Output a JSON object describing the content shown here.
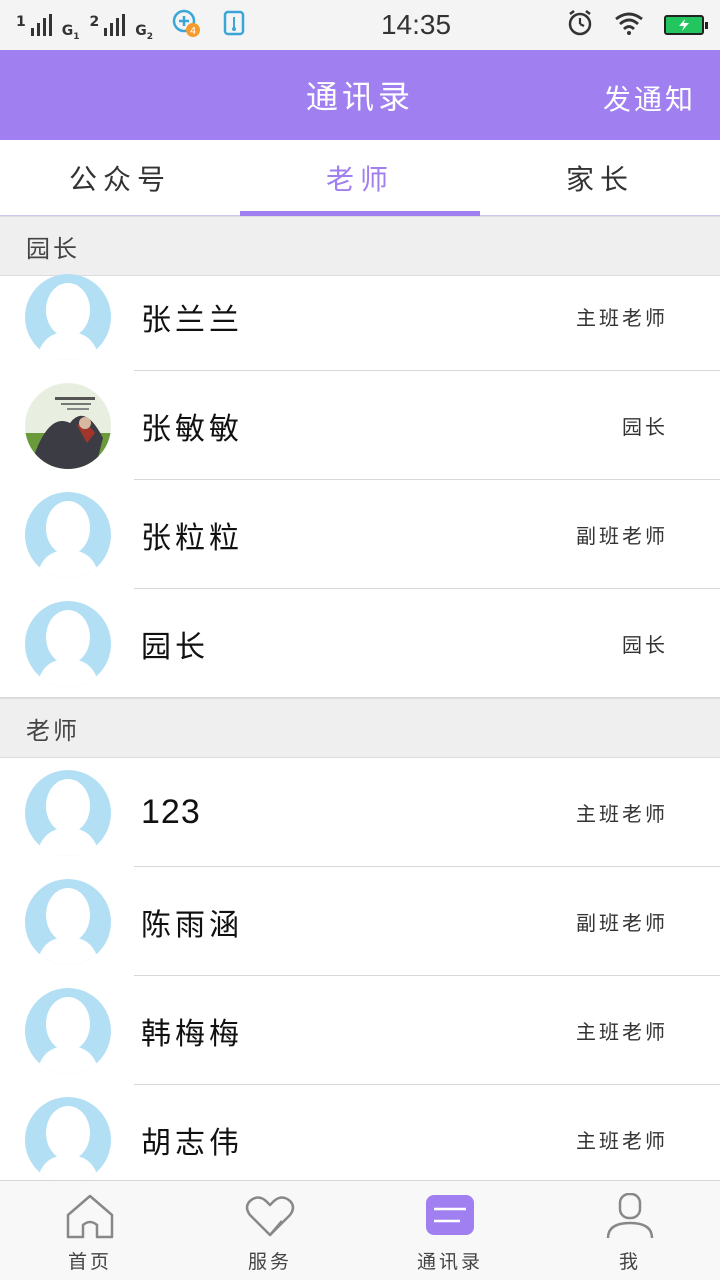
{
  "status_bar": {
    "sim1_label": "1",
    "sim1_tag": "G",
    "sim1_sub": "1",
    "sim2_label": "2",
    "sim2_tag": "G",
    "sim2_sub": "2",
    "notification_badge": "4",
    "time": "14:35",
    "icons": [
      "signal-icon",
      "data-saver-icon",
      "usb-icon",
      "alarm-icon",
      "wifi-icon",
      "battery-icon"
    ]
  },
  "header": {
    "title": "通讯录",
    "action_label": "发通知",
    "color": "#a080f0"
  },
  "tabs": [
    {
      "label": "公众号",
      "active": false
    },
    {
      "label": "老师",
      "active": true
    },
    {
      "label": "家长",
      "active": false
    }
  ],
  "sections": [
    {
      "title": "园长",
      "contacts": [
        {
          "name": "张兰兰",
          "role": "主班老师",
          "avatar": "default-avatar"
        },
        {
          "name": "张敏敏",
          "role": "园长",
          "avatar": "photo-avatar"
        },
        {
          "name": "张粒粒",
          "role": "副班老师",
          "avatar": "default-avatar"
        },
        {
          "name": "园长",
          "role": "园长",
          "avatar": "default-avatar"
        }
      ]
    },
    {
      "title": "老师",
      "contacts": [
        {
          "name": "123",
          "role": "主班老师",
          "avatar": "default-avatar"
        },
        {
          "name": "陈雨涵",
          "role": "副班老师",
          "avatar": "default-avatar"
        },
        {
          "name": "韩梅梅",
          "role": "主班老师",
          "avatar": "default-avatar"
        },
        {
          "name": "胡志伟",
          "role": "主班老师",
          "avatar": "default-avatar"
        }
      ]
    }
  ],
  "bottom_nav": [
    {
      "label": "首页",
      "icon": "home-icon",
      "active": false
    },
    {
      "label": "服务",
      "icon": "heart-icon",
      "active": false
    },
    {
      "label": "通讯录",
      "icon": "contacts-icon",
      "active": true
    },
    {
      "label": "我",
      "icon": "person-icon",
      "active": false
    }
  ]
}
